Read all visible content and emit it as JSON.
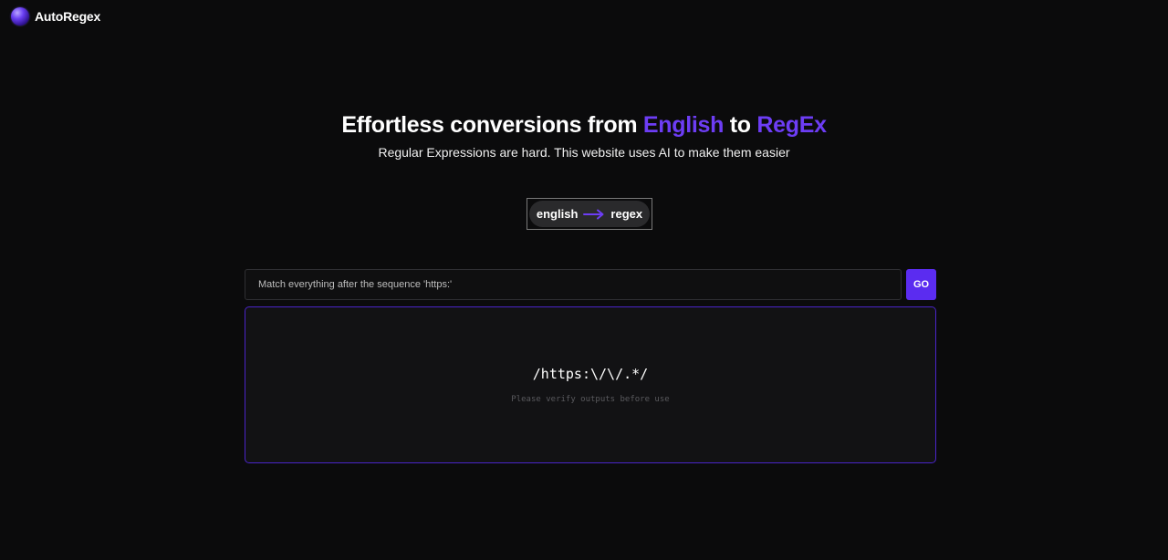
{
  "header": {
    "app_name": "AutoRegex",
    "logo_icon": "purple-orb-logo"
  },
  "hero": {
    "title_prefix": "Effortless conversions from ",
    "title_word_1": "English",
    "title_middle": " to ",
    "title_word_2": "RegEx",
    "subtitle": "Regular Expressions are hard. This website uses AI to make them easier"
  },
  "mode_toggle": {
    "from_label": "english",
    "to_label": "regex",
    "arrow_icon": "long-right-arrow-icon"
  },
  "query": {
    "value": "Match everything after the sequence 'https:'",
    "go_label": "GO"
  },
  "output": {
    "regex": "/https:\\/\\/.*/",
    "note": "Please verify outputs before use"
  },
  "colors": {
    "background": "#0b0b0c",
    "accent": "#6d3df5",
    "button": "#5b2cf0",
    "panel_border": "#4a24c9"
  }
}
